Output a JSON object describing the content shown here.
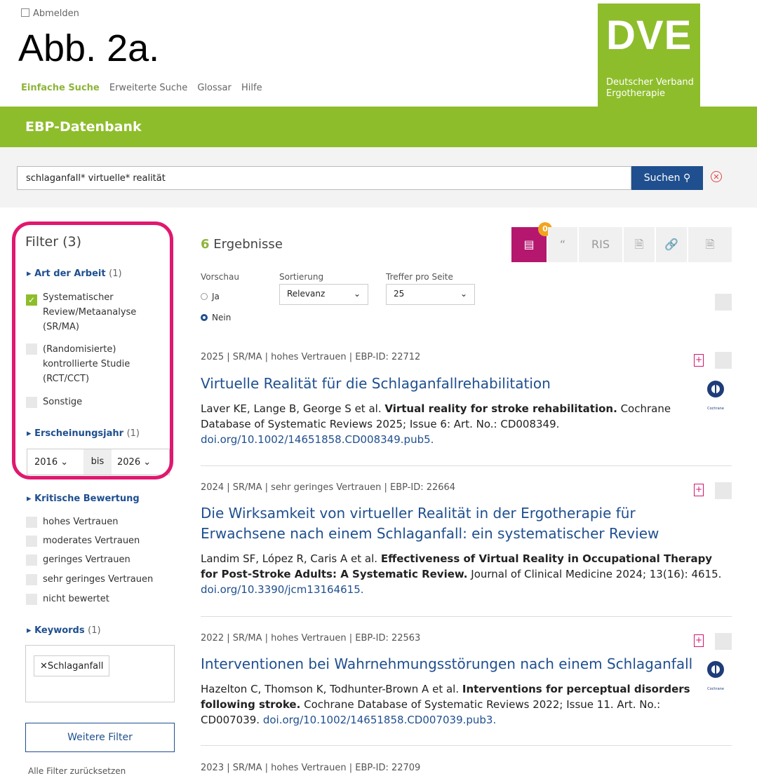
{
  "header": {
    "logout_label": "Abmelden",
    "figure_label": "Abb. 2a.",
    "nav": [
      "Einfache Suche",
      "Erweiterte Suche",
      "Glossar",
      "Hilfe"
    ],
    "logo_big": "DVE",
    "logo_line1": "Deutscher Verband",
    "logo_line2": "Ergotherapie",
    "brand_color": "#8ebd2b"
  },
  "band": {
    "title": "EBP-Datenbank"
  },
  "search": {
    "value": "schlaganfall* virtuelle* realität",
    "button_label": "Suchen"
  },
  "sidebar": {
    "filter_title": "Filter (3)",
    "art": {
      "label": "Art der Arbeit",
      "count": "(1)",
      "items": [
        "Systematischer Review/Metaanalyse (SR/MA)",
        "(Randomisierte) kontrollierte Studie (RCT/CCT)",
        "Sonstige"
      ]
    },
    "jahr": {
      "label": "Erscheinungsjahr",
      "count": "(1)",
      "from": "2016",
      "bis": "bis",
      "to": "2026"
    },
    "bewertung": {
      "label": "Kritische Bewertung",
      "items": [
        "hohes Vertrauen",
        "moderates Vertrauen",
        "geringes Vertrauen",
        "sehr geringes Vertrauen",
        "nicht bewertet"
      ]
    },
    "keywords": {
      "label": "Keywords",
      "count": "(1)",
      "tag": "Schlaganfall"
    },
    "more_button": "Weitere Filter",
    "reset_partial": "Alle Filter zurücksetzen"
  },
  "results": {
    "count": "6",
    "count_label": "Ergebnisse",
    "badge": "0",
    "toolbar": [
      "RIS"
    ],
    "vorschau_label": "Vorschau",
    "vorschau_options": [
      "Ja",
      "Nein"
    ],
    "sort_label": "Sortierung",
    "sort_value": "Relevanz",
    "per_page_label": "Treffer pro Seite",
    "per_page_value": "25",
    "items": [
      {
        "meta": "2025 | SR/MA | hohes Vertrauen | EBP-ID: 22712",
        "title": "Virtuelle Realität für die Schlaganfallrehabilitation",
        "authors": "Laver KE, Lange B, George S et al.",
        "article": "Virtual reality for stroke rehabilitation.",
        "source": "Cochrane Database of Systematic Reviews 2025; Issue 6: Art. No.: CD008349.",
        "doi": "doi.org/10.1002/14651858.CD008349.pub5."
      },
      {
        "meta": "2024 | SR/MA | sehr geringes Vertrauen | EBP-ID: 22664",
        "title": "Die Wirksamkeit von virtueller Realität in der Ergotherapie für Erwachsene nach einem Schlaganfall: ein systematischer Review",
        "authors": "Landim SF, López R, Caris A et al.",
        "article": "Effectiveness of Virtual Reality in Occupational Therapy for Post-Stroke Adults: A Systematic Review.",
        "source": "Journal of Clinical Medicine 2024; 13(16): 4615.",
        "doi": "doi.org/10.3390/jcm13164615."
      },
      {
        "meta": "2022 | SR/MA | hohes Vertrauen | EBP-ID: 22563",
        "title": "Interventionen bei Wahrnehmungsstörungen nach einem Schlaganfall",
        "authors": "Hazelton C, Thomson K, Todhunter-Brown A et al.",
        "article": "Interventions for perceptual disorders following stroke.",
        "source": "Cochrane Database of Systematic Reviews 2022; Issue 11. Art. No.: CD007039.",
        "doi": "doi.org/10.1002/14651858.CD007039.pub3."
      },
      {
        "meta": "2023 | SR/MA | hohes Vertrauen | EBP-ID: 22709"
      }
    ],
    "cochrane_label": "Cochrane"
  }
}
